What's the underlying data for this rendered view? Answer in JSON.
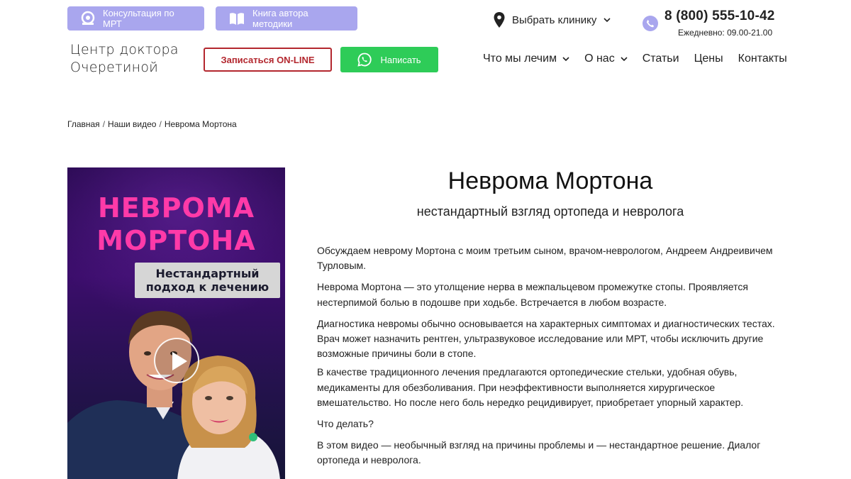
{
  "top_bar": {
    "mri_button": "Консультация по МРТ",
    "book_button": "Книга автора методики",
    "clinic_select": "Выбрать клинику",
    "phone": "8 (800) 555-10-42",
    "hours": "Ежедневно: 09.00-21.00"
  },
  "header": {
    "logo_line1": "Центр доктора",
    "logo_line2": "Очеретиной",
    "online_button": "Записаться ON-LINE",
    "write_button": "Написать"
  },
  "nav": {
    "items": [
      "Что мы лечим",
      "О нас",
      "Статьи",
      "Цены",
      "Контакты"
    ]
  },
  "breadcrumb": {
    "items": [
      "Главная",
      "Наши видео",
      "Неврома Мортона"
    ],
    "separator": "/"
  },
  "video": {
    "title_line1": "НЕВРОМА",
    "title_line2": "МОРТОНА",
    "badge_line1": "Нестандартный",
    "badge_line2": "подход к лечению"
  },
  "article": {
    "title": "Неврома Мортона",
    "subtitle": "нестандартный взгляд ортопеда и невролога",
    "paragraphs": [
      "Обсуждаем неврому Мортона с моим третьим сыном, врачом-неврологом, Андреем Андреивичем Турловым.",
      "Неврома Мортона — это утолщение нерва в межпальцевом промежутке стопы. Проявляется нестерпимой болью в подошве при ходьбе. Встречается в любом возрасте.",
      "Диагностика невромы обычно основывается на характерных симптомах и диагностических тестах. Врач может назначить рентген, ультразвуковое исследование или МРТ, чтобы исключить другие возможные причины боли в стопе.",
      "В качестве традиционного лечения предлагаются ортопедические стельки, удобная обувь, медикаменты для обезболивания. При неэффективности выполняется хирургическое вмешательство. Но после него боль нередко рецидивирует, приобретает упорный характер.",
      "Что делать?",
      "В этом видео — необычный взгляд на причины проблемы и — нестандартное решение. Диалог ортопеда и невролога."
    ]
  },
  "colors": {
    "accent_purple": "#a9a6ee",
    "online_red": "#b3272e",
    "whatsapp_green": "#2ecc58",
    "video_pink": "#ff3aa8"
  }
}
